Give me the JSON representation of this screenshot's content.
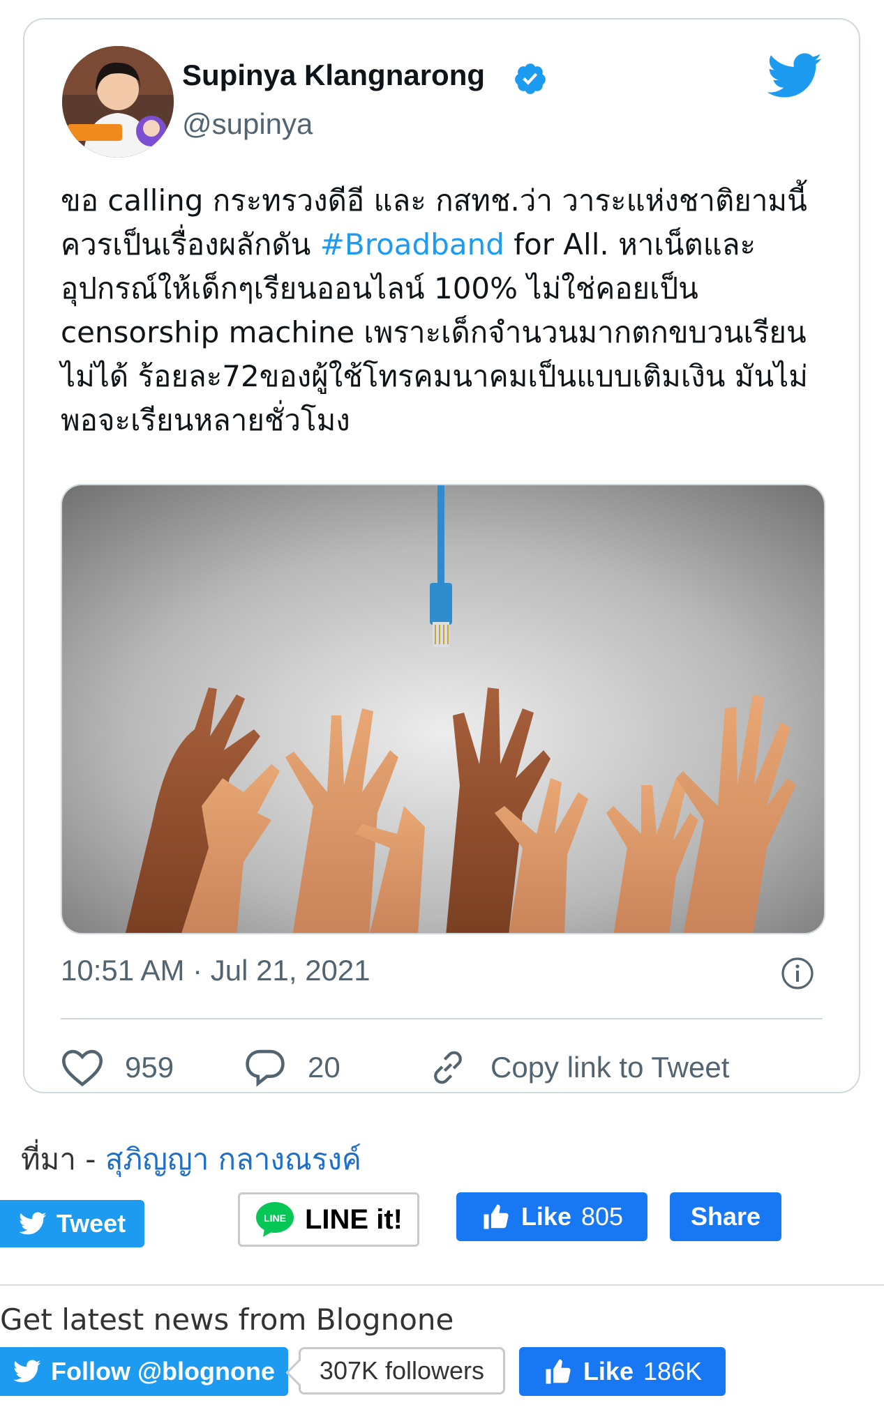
{
  "tweet": {
    "author_name": "Supinya Klangnarong",
    "handle": "@supinya",
    "text_before": "ขอ calling กระทรวงดีอี และ กสทช.ว่า วาระแห่งชาติยามนี้ควรเป็นเรื่องผลักดัน ",
    "hashtag": "#Broadband",
    "text_after": " for All. หาเน็ตและอุปกรณ์ให้เด็กๆเรียนออนไลน์ 100% ไม่ใช่คอยเป็น censorship machine เพราะเด็กจำนวนมากตกขบวนเรียนไม่ได้ ร้อยละ72ของผู้ใช้โทรคมนาคมเป็นแบบเติมเงิน มันไม่พอจะเรียนหลายชั่วโมง",
    "timestamp": "10:51 AM · Jul 21, 2021",
    "likes": "959",
    "replies": "20",
    "copy_link_label": "Copy link to Tweet",
    "avatar_caption": "Supinya Klangnarong"
  },
  "source": {
    "prefix": "ที่มา - ",
    "link_text": "สุภิญญา กลางณรงค์"
  },
  "share_bar": {
    "tweet_label": "Tweet",
    "line_label": "LINE it!",
    "line_badge": "LINE",
    "like_label": "Like",
    "like_count": "805",
    "share_label": "Share"
  },
  "follow_bar": {
    "heading": "Get latest news from Blognone",
    "follow_label": "Follow @blognone",
    "followers_count": "307K followers",
    "like_label": "Like",
    "like_count": "186K"
  },
  "colors": {
    "twitter_blue": "#1d9bf0",
    "facebook_blue": "#1877f2",
    "line_green": "#06c755",
    "link_blue": "#1d6fc9"
  },
  "icons": [
    "twitter-bird-icon",
    "verified-badge-icon",
    "info-icon",
    "heart-icon",
    "reply-icon",
    "link-icon",
    "thumbs-up-icon",
    "line-logo-icon"
  ]
}
